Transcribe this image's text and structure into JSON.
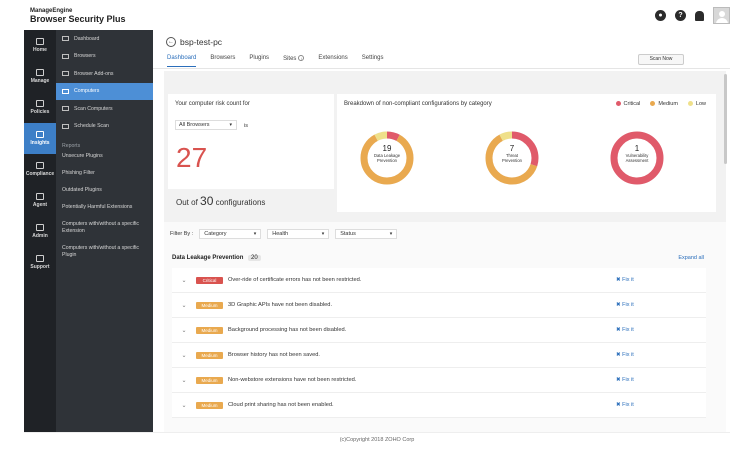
{
  "brand": {
    "company": "ManageEngine",
    "product": "Browser Security Plus"
  },
  "rail": [
    {
      "label": "Home",
      "icon": "home-icon"
    },
    {
      "label": "Manage",
      "icon": "gear-icon"
    },
    {
      "label": "Policies",
      "icon": "document-icon"
    },
    {
      "label": "Insights",
      "icon": "lightbulb-icon",
      "active": true
    },
    {
      "label": "Compliance",
      "icon": "clipboard-icon"
    },
    {
      "label": "Agent",
      "icon": "globe-icon"
    },
    {
      "label": "Admin",
      "icon": "user-icon"
    },
    {
      "label": "Support",
      "icon": "headset-icon"
    }
  ],
  "submenu": {
    "items": [
      {
        "label": "Dashboard"
      },
      {
        "label": "Browsers"
      },
      {
        "label": "Browser Add-ons"
      },
      {
        "label": "Computers",
        "active": true
      },
      {
        "label": "Scan Computers"
      },
      {
        "label": "Schedule Scan"
      }
    ],
    "reports_heading": "Reports",
    "reports": [
      "Unsecure Plugins",
      "Phishing Filter",
      "Outdated Plugins",
      "Potentially Harmful Extensions",
      "Computers with/without a specific Extension",
      "Computers with/without a specific Plugin"
    ]
  },
  "page": {
    "title": "bsp-test-pc",
    "tabs": [
      "Dashboard",
      "Browsers",
      "Plugins",
      "Sites",
      "Extensions",
      "Settings"
    ],
    "active_tab": "Dashboard",
    "scan_button": "Scan Now"
  },
  "risk": {
    "label": "Your computer risk count for",
    "browser_select": "All Browsers",
    "is_text": "is",
    "count": "27",
    "out_of_prefix": "Out of",
    "total": "30",
    "out_of_suffix": "configurations"
  },
  "breakdown": {
    "label": "Breakdown of non-compliant configurations by category",
    "legend": [
      {
        "name": "Critical",
        "color": "#e05a6a"
      },
      {
        "name": "Medium",
        "color": "#e9a94f"
      },
      {
        "name": "Low",
        "color": "#efe08a"
      }
    ],
    "donuts": [
      {
        "value": "19",
        "name1": "Data Leakage",
        "name2": "Prevention",
        "critical": 0.08,
        "medium": 0.84,
        "low": 0.08
      },
      {
        "value": "7",
        "name1": "Threat",
        "name2": "Prevention",
        "critical": 0.3,
        "medium": 0.62,
        "low": 0.08
      },
      {
        "value": "1",
        "name1": "Vulnerability",
        "name2": "Assessment",
        "critical": 1.0,
        "medium": 0,
        "low": 0
      }
    ]
  },
  "filters": {
    "label": "Filter By :",
    "selects": [
      "Category",
      "Health",
      "Status"
    ]
  },
  "section": {
    "title": "Data Leakage Prevention",
    "count": "20",
    "expand": "Expand all"
  },
  "rows": [
    {
      "severity": "Critical",
      "text": "Over-ride of certificate errors has not been restricted.",
      "fix": "Fix it"
    },
    {
      "severity": "Medium",
      "text": "3D Graphic APIs have not been disabled.",
      "fix": "Fix it"
    },
    {
      "severity": "Medium",
      "text": "Background processing has not been disabled.",
      "fix": "Fix it"
    },
    {
      "severity": "Medium",
      "text": "Browser history has not been saved.",
      "fix": "Fix it"
    },
    {
      "severity": "Medium",
      "text": "Non-webstore extensions have not been restricted.",
      "fix": "Fix it"
    },
    {
      "severity": "Medium",
      "text": "Cloud print sharing has not been enabled.",
      "fix": "Fix it"
    }
  ],
  "footer": "(c)Copyright 2018 ZOHO Corp"
}
